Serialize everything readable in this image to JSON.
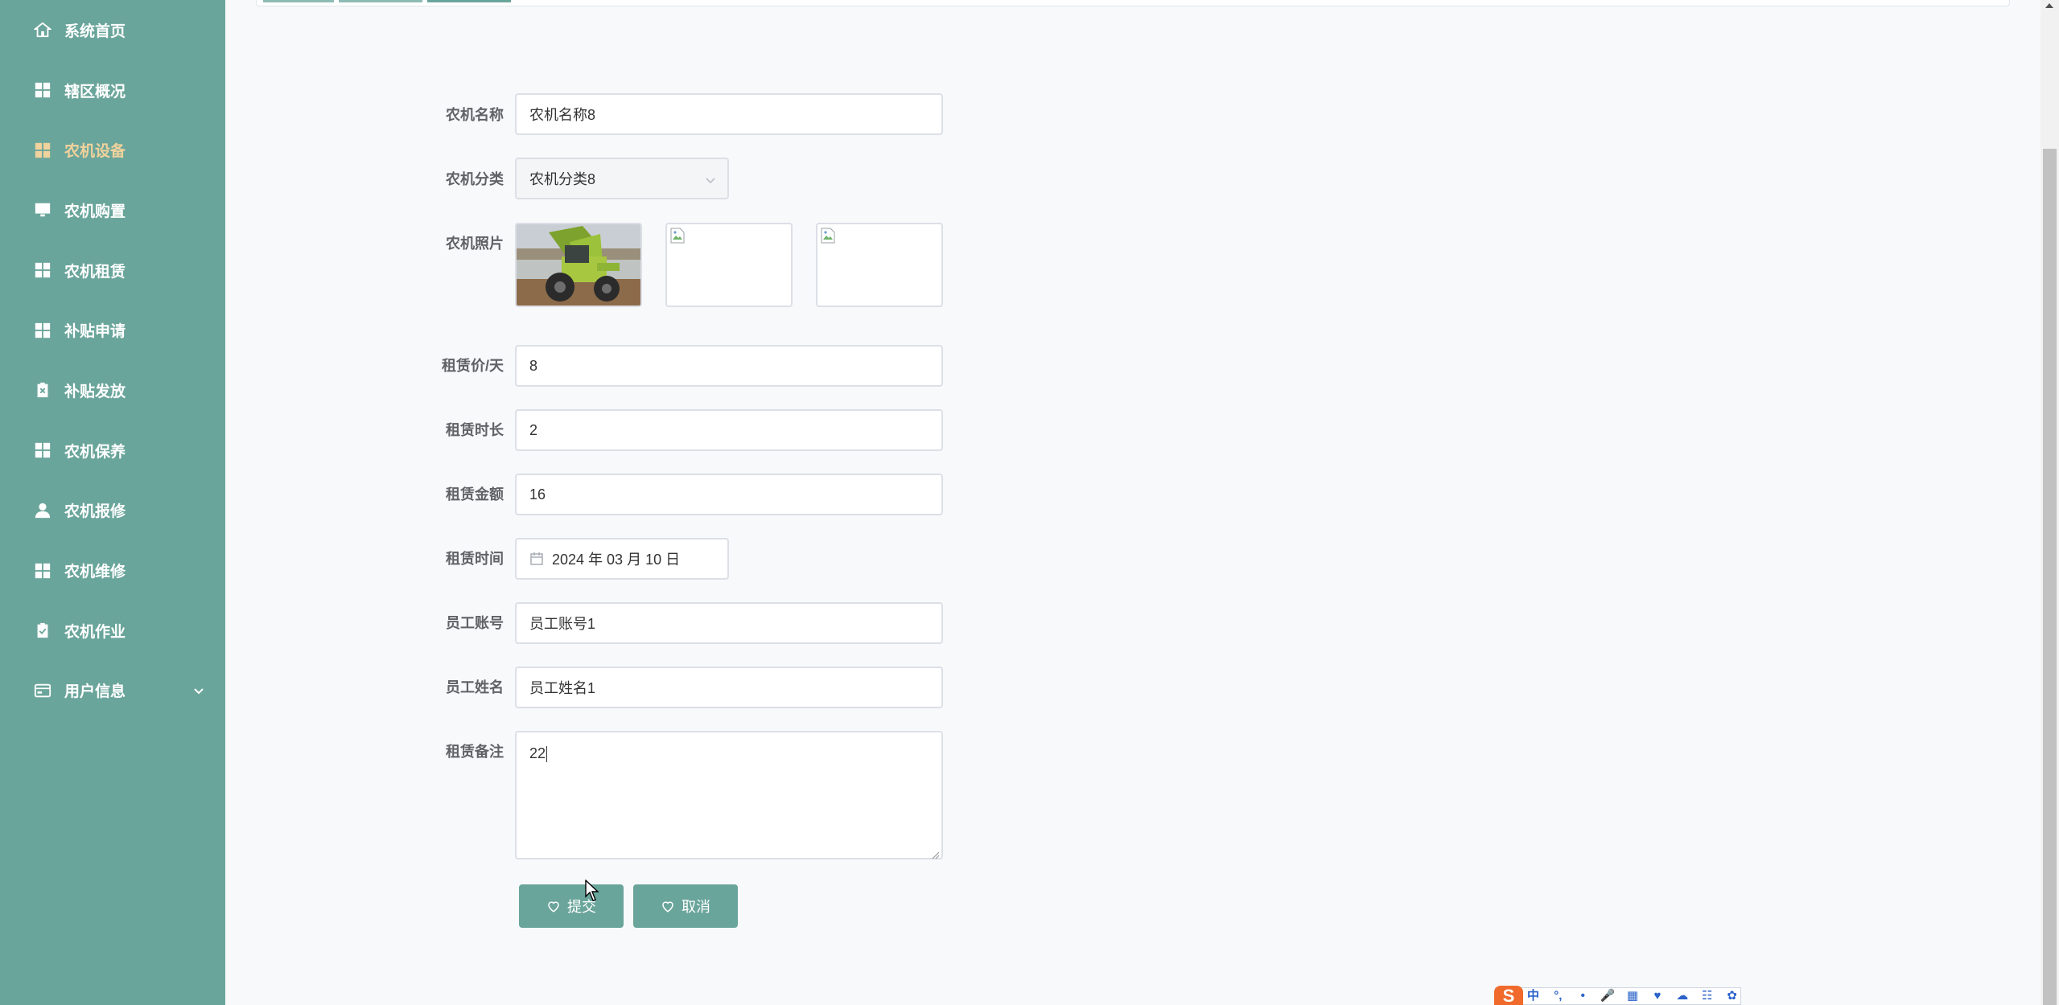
{
  "sidebar": {
    "items": [
      {
        "label": "系统首页",
        "icon": "home-icon"
      },
      {
        "label": "辖区概况",
        "icon": "grid-icon"
      },
      {
        "label": "农机设备",
        "icon": "grid-icon",
        "active": true
      },
      {
        "label": "农机购置",
        "icon": "monitor-icon"
      },
      {
        "label": "农机租赁",
        "icon": "grid-icon"
      },
      {
        "label": "补贴申请",
        "icon": "grid-icon"
      },
      {
        "label": "补贴发放",
        "icon": "clipboard-x-icon"
      },
      {
        "label": "农机保养",
        "icon": "grid-icon"
      },
      {
        "label": "农机报修",
        "icon": "user-icon"
      },
      {
        "label": "农机维修",
        "icon": "grid-icon"
      },
      {
        "label": "农机作业",
        "icon": "clipboard-check-icon"
      },
      {
        "label": "用户信息",
        "icon": "card-icon",
        "expandable": true
      }
    ],
    "active_color": "#f0d29c",
    "bg_color": "#6aa59b"
  },
  "form": {
    "machine_name": {
      "label": "农机名称",
      "value": "农机名称8"
    },
    "machine_category": {
      "label": "农机分类",
      "value": "农机分类8"
    },
    "machine_photo": {
      "label": "农机照片"
    },
    "rent_price": {
      "label": "租赁价/天",
      "value": "8"
    },
    "rent_duration": {
      "label": "租赁时长",
      "value": "2"
    },
    "rent_amount": {
      "label": "租赁金额",
      "value": "16"
    },
    "rent_date": {
      "label": "租赁时间",
      "value": "2024 年 03 月 10 日"
    },
    "staff_account": {
      "label": "员工账号",
      "value": "员工账号1"
    },
    "staff_name": {
      "label": "员工姓名",
      "value": "员工姓名1"
    },
    "rent_notes": {
      "label": "租赁备注",
      "value": "22"
    }
  },
  "buttons": {
    "submit": "提交",
    "cancel": "取消"
  },
  "ime_toolbar": {
    "logo": "S",
    "items": [
      "中",
      "°,",
      "•",
      "🎤",
      "▦",
      "♥",
      "☁",
      "☷",
      "✿"
    ]
  }
}
